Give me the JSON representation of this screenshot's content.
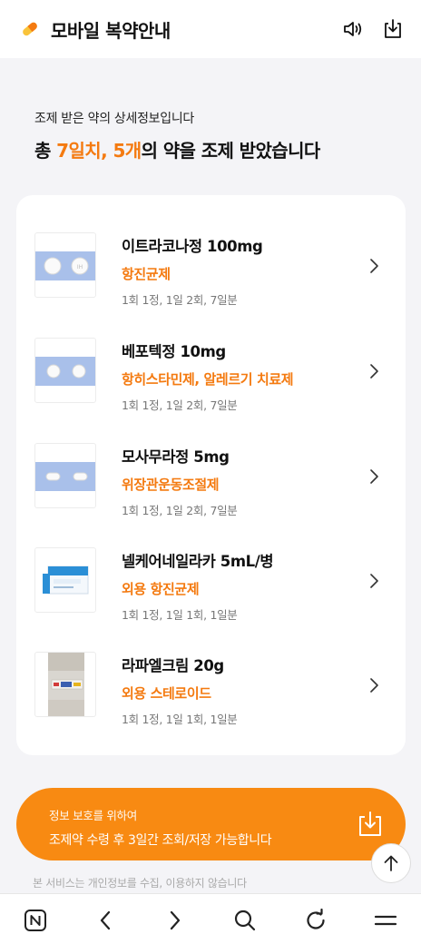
{
  "header": {
    "title": "모바일 복약안내",
    "logo_icon": "pill-icon",
    "sound_icon": "speaker-icon",
    "download_icon": "download-icon"
  },
  "intro": {
    "subtitle": "조제 받은 약의 상세정보입니다",
    "title_prefix": "총 ",
    "title_days": "7일치, 5개",
    "title_suffix": "의 약을 조제 받았습니다"
  },
  "medications": [
    {
      "name": "이트라코나정 100mg",
      "type": "항진균제",
      "dosage": "1회 1정, 1일 2회, 7일분"
    },
    {
      "name": "베포텍정 10mg",
      "type": "항히스타민제, 알레르기 치료제",
      "dosage": "1회 1정, 1일 2회, 7일분"
    },
    {
      "name": "모사무라정 5mg",
      "type": "위장관운동조절제",
      "dosage": "1회 1정, 1일 2회, 7일분"
    },
    {
      "name": "넬케어네일라카 5mL/병",
      "type": "외용 항진균제",
      "dosage": "1회 1정, 1일 1회, 1일분"
    },
    {
      "name": "라파엘크림 20g",
      "type": "외용 스테로이드",
      "dosage": "1회 1정, 1일 1회, 1일분"
    }
  ],
  "banner": {
    "line1": "정보 보호를 위하여",
    "line2": "조제약 수령 후 3일간 조회/저장 가능합니다"
  },
  "notice": "본 서비스는 개인정보를 수집, 이용하지 않습니다",
  "colors": {
    "accent": "#f47a10",
    "banner": "#f88a12",
    "pill_band": "#a9c0ea"
  },
  "bottom_nav": [
    "naver-home-icon",
    "back-icon",
    "forward-icon",
    "search-icon",
    "refresh-icon",
    "menu-icon"
  ]
}
